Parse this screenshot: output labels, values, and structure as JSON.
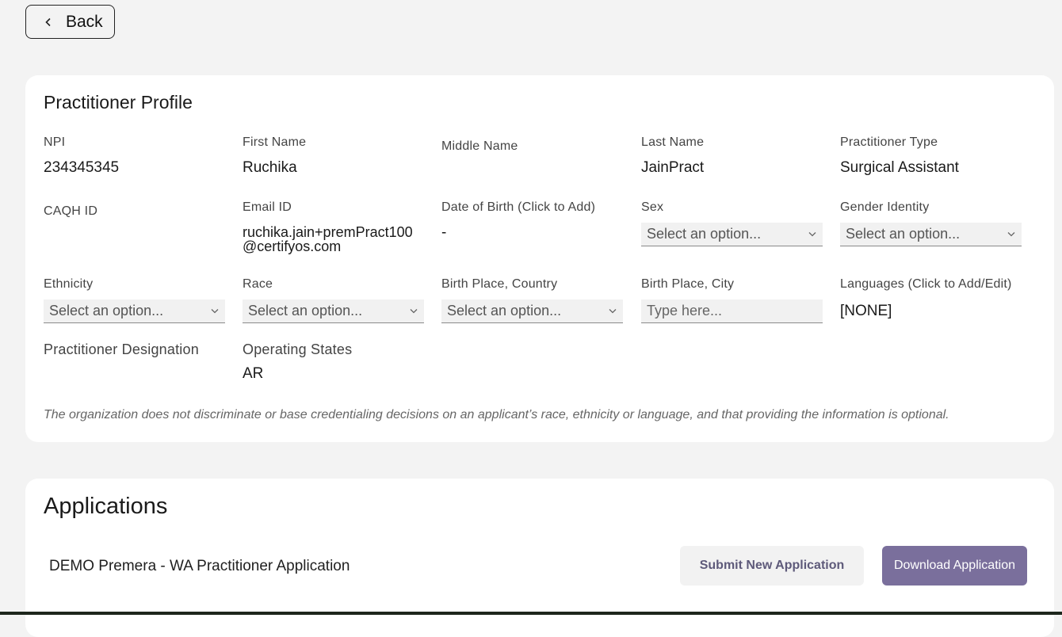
{
  "back_button": {
    "label": "Back"
  },
  "profile": {
    "title": "Practitioner Profile",
    "fields": {
      "npi": {
        "label": "NPI",
        "value": "234345345"
      },
      "first_name": {
        "label": "First Name",
        "value": "Ruchika"
      },
      "middle_name": {
        "label": "Middle Name",
        "value": ""
      },
      "last_name": {
        "label": "Last Name",
        "value": "JainPract"
      },
      "practitioner_type": {
        "label": "Practitioner Type",
        "value": "Surgical Assistant"
      },
      "caqh_id": {
        "label": "CAQH ID",
        "value": ""
      },
      "email": {
        "label": "Email ID",
        "value": "ruchika.jain+premPract100 @certifyos.com"
      },
      "dob": {
        "label": "Date of Birth (Click to Add)",
        "value": "-"
      },
      "sex": {
        "label": "Sex",
        "selected": "Select an option..."
      },
      "gender_identity": {
        "label": "Gender Identity",
        "selected": "Select an option..."
      },
      "ethnicity": {
        "label": "Ethnicity",
        "selected": "Select an option..."
      },
      "race": {
        "label": "Race",
        "selected": "Select an option..."
      },
      "birth_country": {
        "label": "Birth Place, Country",
        "selected": "Select an option..."
      },
      "birth_city": {
        "label": "Birth Place, City",
        "placeholder": "Type here..."
      },
      "languages": {
        "label": "Languages (Click to Add/Edit)",
        "value": "[NONE]"
      },
      "designation": {
        "label": "Practitioner Designation",
        "value": ""
      },
      "operating_states": {
        "label": "Operating States",
        "value": "AR"
      }
    },
    "disclaimer": "The organization does not discriminate or base credentialing decisions on an applicant’s race, ethnicity or language, and that providing the information is optional."
  },
  "applications": {
    "title": "Applications",
    "items": [
      {
        "name": "DEMO Premera - WA Practitioner Application"
      }
    ],
    "submit_label": "Submit New Application",
    "download_label": "Download Application"
  },
  "colors": {
    "accent": "#7a6f9c",
    "submit_text": "#5e5a7a",
    "page_bg": "#f3f3f3",
    "card_bg": "#ffffff"
  },
  "icons": {
    "back": "chevron-left-icon",
    "select": "chevron-down-icon"
  }
}
